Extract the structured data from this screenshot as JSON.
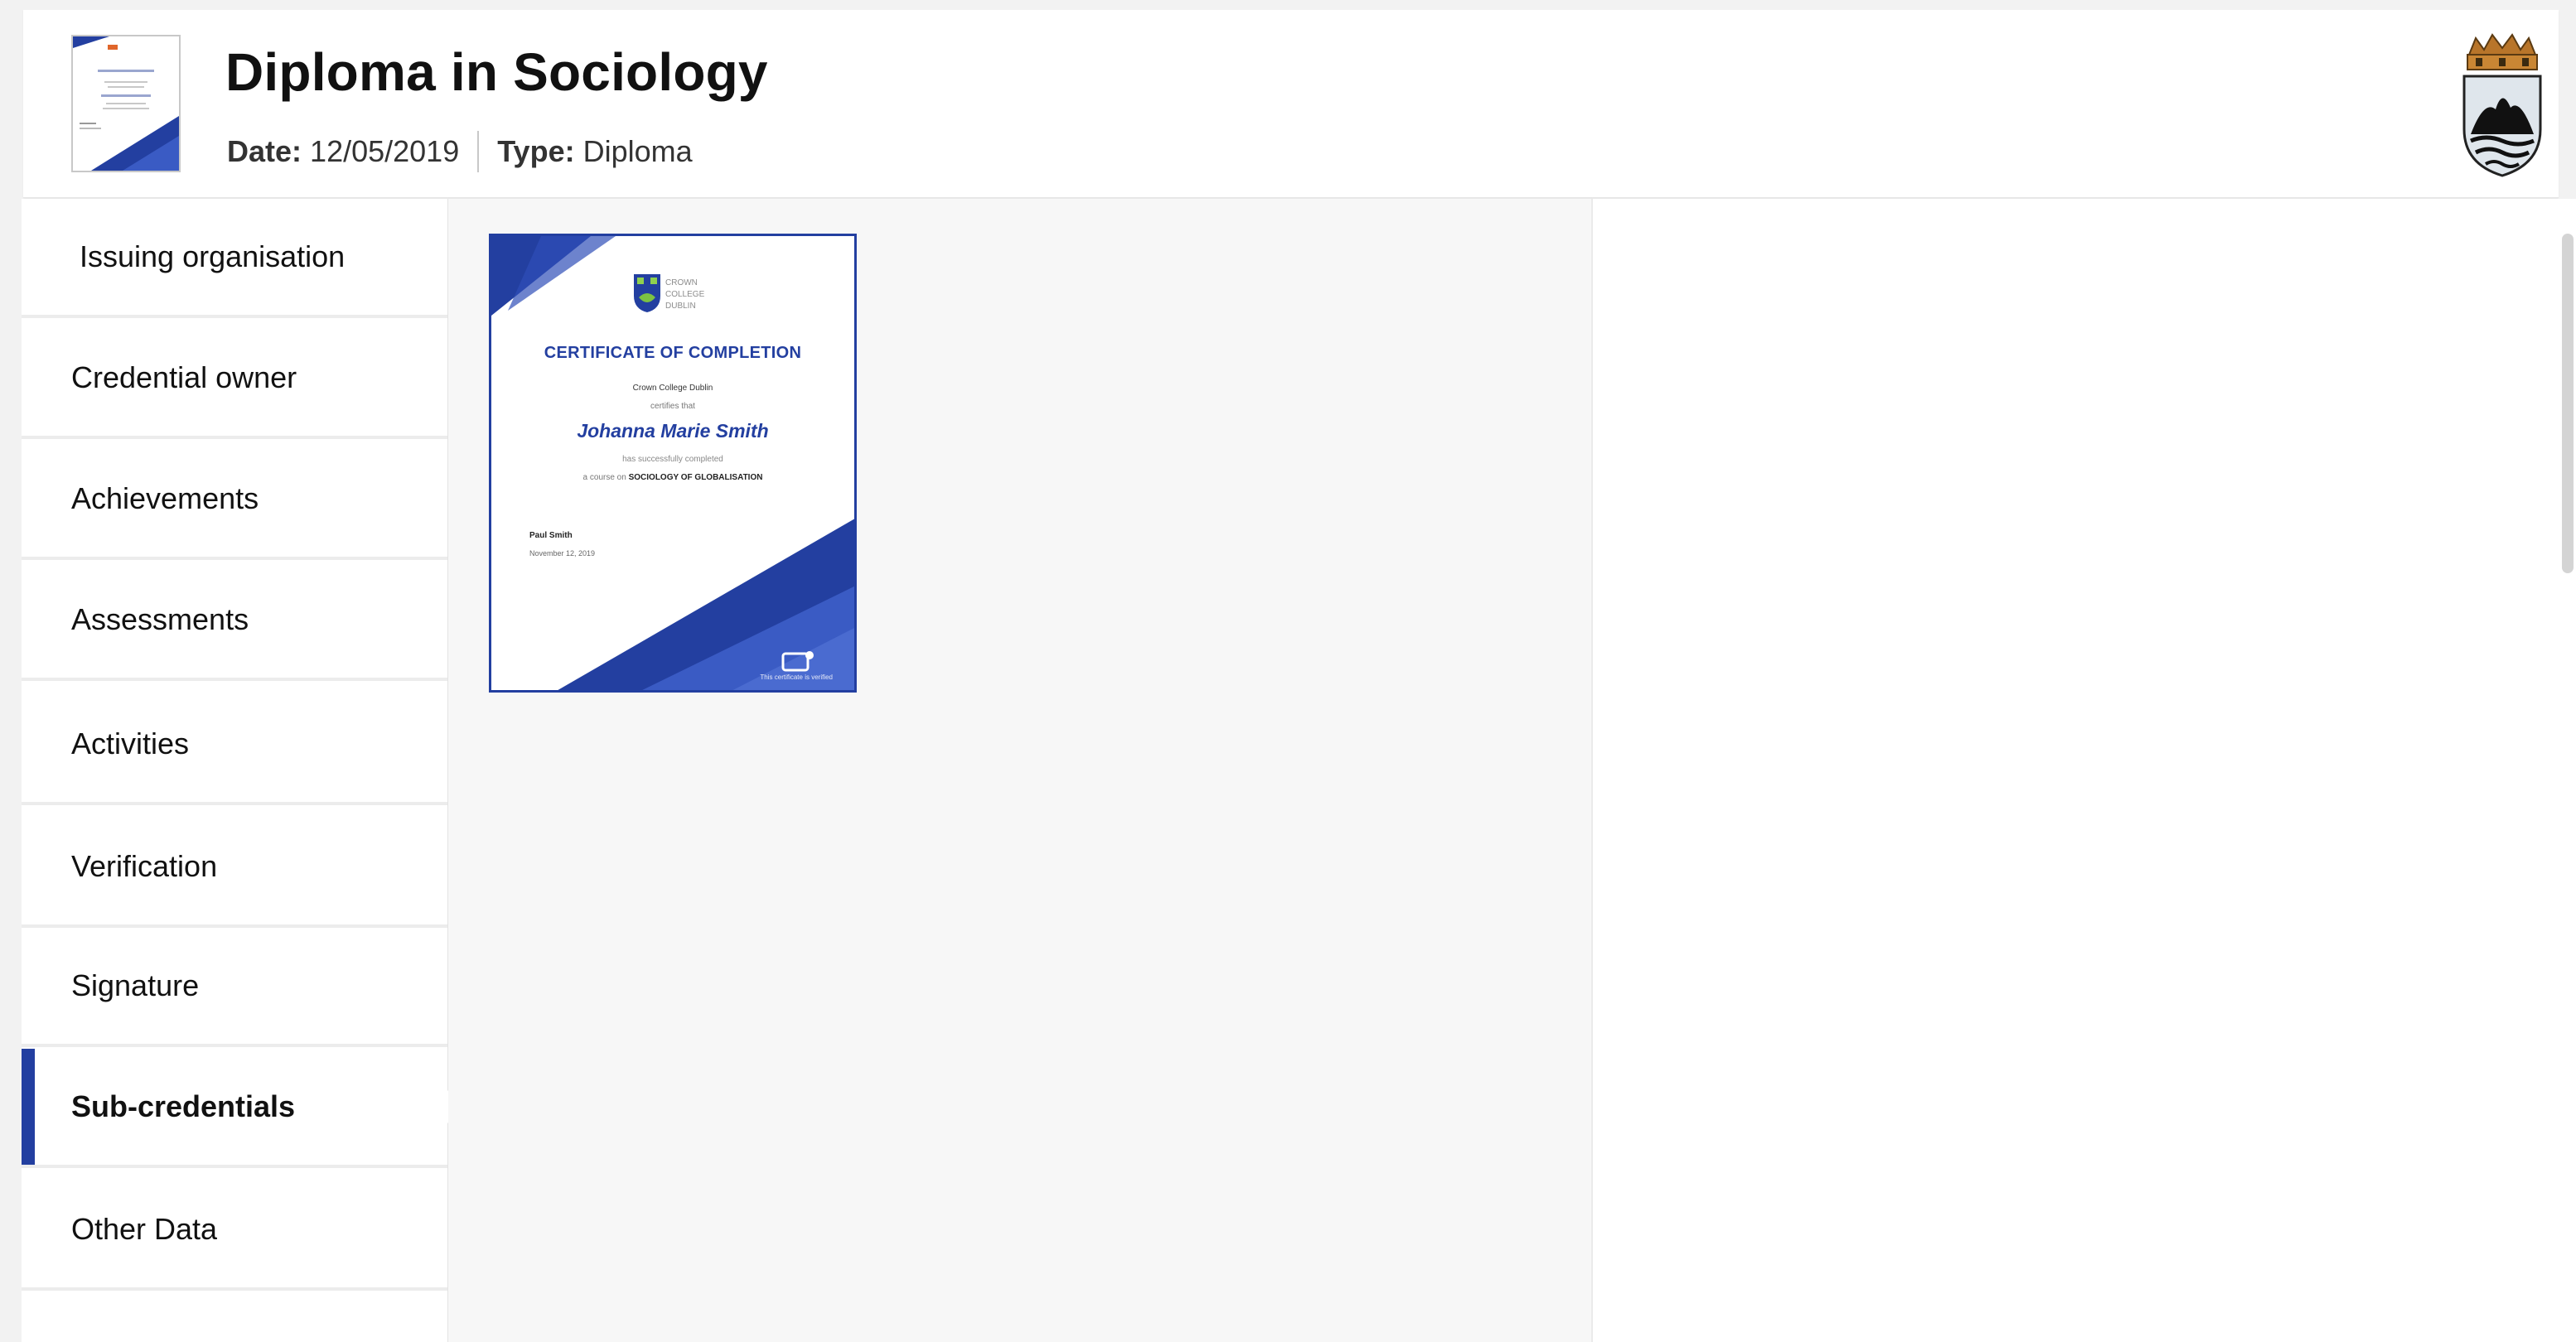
{
  "header": {
    "title": "Diploma in Sociology",
    "date_label": "Date:",
    "date_value": "12/05/2019",
    "type_label": "Type:",
    "type_value": "Diploma"
  },
  "sidebar": {
    "items": [
      {
        "label": "Issuing organisation",
        "active": false
      },
      {
        "label": "Credential owner",
        "active": false
      },
      {
        "label": "Achievements",
        "active": false
      },
      {
        "label": "Assessments",
        "active": false
      },
      {
        "label": "Activities",
        "active": false
      },
      {
        "label": "Verification",
        "active": false
      },
      {
        "label": "Signature",
        "active": false
      },
      {
        "label": "Sub-credentials",
        "active": true
      },
      {
        "label": "Other Data",
        "active": false
      }
    ]
  },
  "certificate": {
    "org_lines": [
      "CROWN",
      "COLLEGE",
      "DUBLIN"
    ],
    "heading": "CERTIFICATE OF COMPLETION",
    "issuer": "Crown College Dublin",
    "certifies": "certifies that",
    "recipient": "Johanna Marie Smith",
    "completed": "has successfully completed",
    "course_prefix": "a course on",
    "course_name": "SOCIOLOGY OF GLOBALISATION",
    "signer": "Paul Smith",
    "date": "November 12, 2019",
    "verified_note": "This certificate is verified"
  },
  "colors": {
    "accent": "#233fa0",
    "active_bar": "#233fa0",
    "panel_bg": "#f7f7f7"
  }
}
